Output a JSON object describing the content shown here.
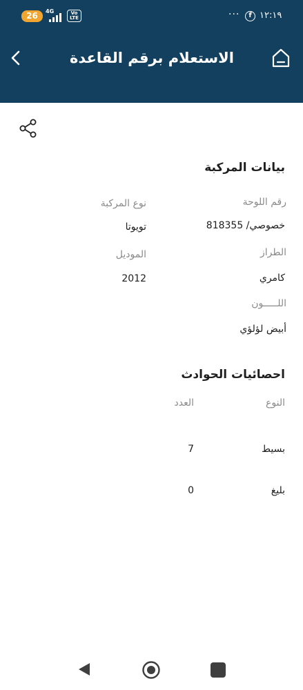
{
  "status_bar": {
    "battery": "26",
    "network": "4G",
    "volte": "Vo\nLTE",
    "dots": "···",
    "fb_glyph": "f",
    "time": "١٢:١٩"
  },
  "header": {
    "title": "الاستعلام برقم القاعدة",
    "home_icon": "home-icon",
    "back_icon": "chevron-left-icon",
    "color": "#13405f"
  },
  "share_icon": "share-icon",
  "vehicle": {
    "section_title": "بيانات المركبة",
    "plate_label": "رقم اللوحة",
    "plate_value": "خصوصي/ 818355",
    "type_label": "نوع المركبة",
    "type_value": "تويوتا",
    "make_label": "الطراز",
    "make_value": "كامري",
    "model_label": "الموديل",
    "model_value": "2012",
    "color_label": "اللـــــون",
    "color_value": "أبيض لؤلؤي"
  },
  "accidents": {
    "section_title": "احصائيات الحوادث",
    "col_type": "النوع",
    "col_count": "العدد",
    "rows": [
      {
        "type": "بسيط",
        "count": "7"
      },
      {
        "type": "بليغ",
        "count": "0"
      }
    ]
  },
  "navbar": {
    "back": "back-triangle-icon",
    "home": "home-circle-icon",
    "recent": "recent-apps-icon"
  }
}
